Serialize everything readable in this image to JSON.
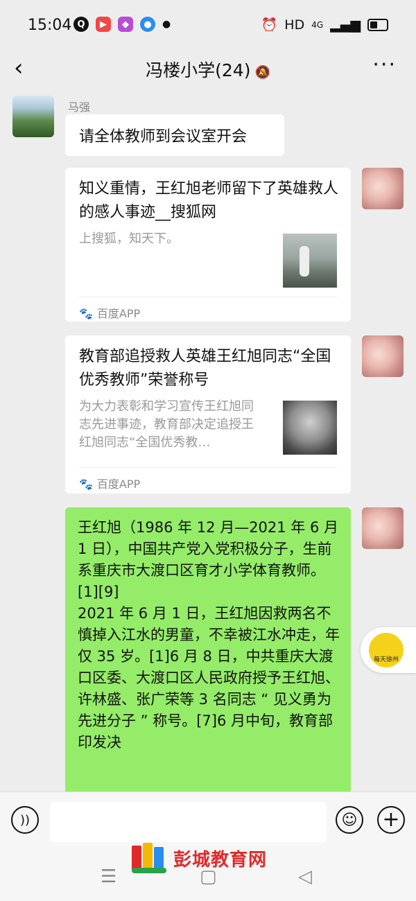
{
  "status": {
    "time": "15:04",
    "app_icons": [
      "q-app-icon",
      "video-app-icon",
      "live-app-icon",
      "browser-app-icon"
    ],
    "hd": "HD",
    "network": "4G"
  },
  "header": {
    "back_icon": "chevron-left-icon",
    "title": "冯楼小学(24)",
    "mute_icon": "bell-off-icon",
    "more_label": "···"
  },
  "messages": {
    "m1": {
      "sender": "马强",
      "text": "请全体教师到会议室开会"
    },
    "c1": {
      "title": "知义重情，王红旭老师留下了英雄救人的感人事迹__搜狐网",
      "desc": "上搜狐，知天下。",
      "source": "百度APP"
    },
    "c2": {
      "title": "教育部追授救人英雄王红旭同志“全国优秀教师”荣誉称号",
      "desc": "为大力表彰和学习宣传王红旭同志先进事迹，教育部决定追授王红旭同志“全国优秀教…",
      "source": "百度APP"
    },
    "t1": {
      "text": "王红旭（1986 年 12 月—2021 年 6 月 1 日），中国共产党入党积极分子，生前系重庆市大渡口区育才小学体育教师。[1][9]\n2021 年 6 月 1 日，王红旭因救两名不慎掉入江水的男童，不幸被江水冲走，年仅 35 岁。[1]6 月 8 日，中共重庆大渡口区委、大渡口区人民政府授予王红旭、许林盛、张广荣等 3 名同志 “ 见义勇为先进分子 ” 称号。[7]6 月中旬，教育部印发决"
    }
  },
  "floating": {
    "label": "每天徐州"
  },
  "input": {
    "placeholder": ""
  },
  "watermark": {
    "text": "彭城教育网"
  },
  "colors": {
    "bg": "#ededed",
    "bubble_green": "#95ec69",
    "card_bg": "#ffffff"
  }
}
